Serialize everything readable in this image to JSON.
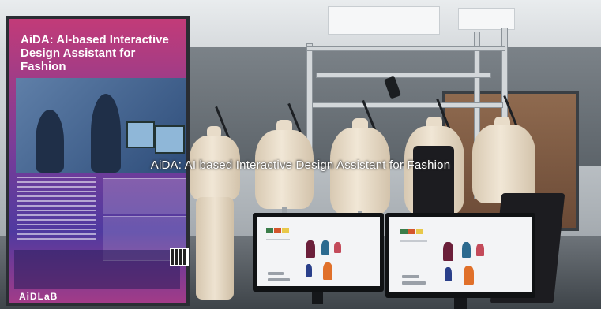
{
  "caption": "AiDA: AI based Interactive Design Assistant for Fashion",
  "poster": {
    "title": "AiDA: AI-based Interactive Design Assistant for Fashion",
    "logo": "AiDLaB"
  },
  "colors": {
    "poster_top": "#c23b78",
    "poster_mid": "#7a3d98",
    "poster_bottom": "#4f3aa0",
    "mannequin": "#eee3d1",
    "dress": "#1c1c20"
  }
}
